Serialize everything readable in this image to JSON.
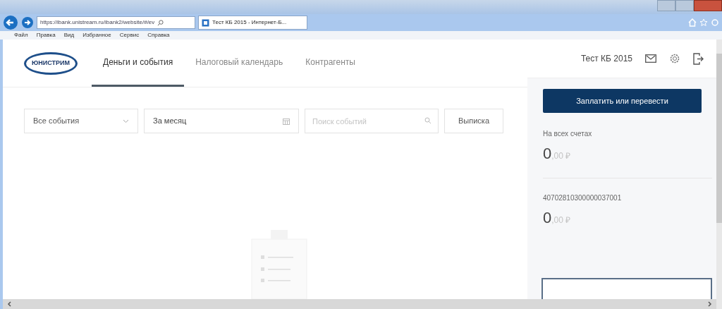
{
  "browser": {
    "address": "https://ibank.unistream.ru/ibank2/website/#/ev",
    "tab_title": "Тест КБ 2015 - Интернет-Б...",
    "menu": [
      "Файл",
      "Правка",
      "Вид",
      "Избранное",
      "Сервис",
      "Справка"
    ]
  },
  "app": {
    "logo": "ЮНИСТРИМ",
    "nav": [
      {
        "label": "Деньги и события",
        "selected": true
      },
      {
        "label": "Налоговый календарь",
        "selected": false
      },
      {
        "label": "Контрагенты",
        "selected": false
      }
    ],
    "user": "Тест КБ 2015"
  },
  "filters": {
    "event_type": "Все события",
    "period": "За месяц",
    "search": {
      "placeholder": "Поиск событий"
    },
    "statement_button": "Выписка"
  },
  "sidebar": {
    "pay_button": "Заплатить или перевести",
    "balances": [
      {
        "label": "На всех счетах",
        "integer": "0",
        "fraction": ",00 ₽"
      },
      {
        "label": "40702810300000037001",
        "integer": "0",
        "fraction": ",00 ₽"
      }
    ]
  }
}
